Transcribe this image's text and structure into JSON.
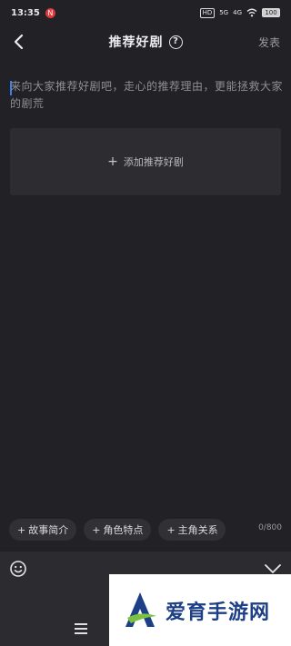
{
  "status_bar": {
    "time": "13:35",
    "notification_badge": "N",
    "indicators": [
      "HD",
      "5G",
      "4G",
      "wifi-icon"
    ],
    "battery": "100"
  },
  "header": {
    "title": "推荐好剧",
    "help_icon": "?",
    "publish_label": "发表"
  },
  "editor": {
    "placeholder": "来向大家推荐好剧吧，走心的推荐理由，更能拯救大家的剧荒"
  },
  "add_button": {
    "plus": "+",
    "label": "添加推荐好剧"
  },
  "chips": [
    {
      "plus": "+",
      "label": "故事简介"
    },
    {
      "plus": "+",
      "label": "角色特点"
    },
    {
      "plus": "+",
      "label": "主角关系"
    }
  ],
  "counter": "0/800",
  "toolbar": {
    "emoji_icon": "smiley-icon",
    "collapse_icon": "chevron-down-icon"
  },
  "watermark": {
    "logo_icon": "aiyu-logo",
    "text": "爱育手游网"
  },
  "colors": {
    "background": "#222226",
    "panel": "#2c2c31",
    "caret": "#3b7cf0",
    "watermark_text": "#1d3f86"
  }
}
